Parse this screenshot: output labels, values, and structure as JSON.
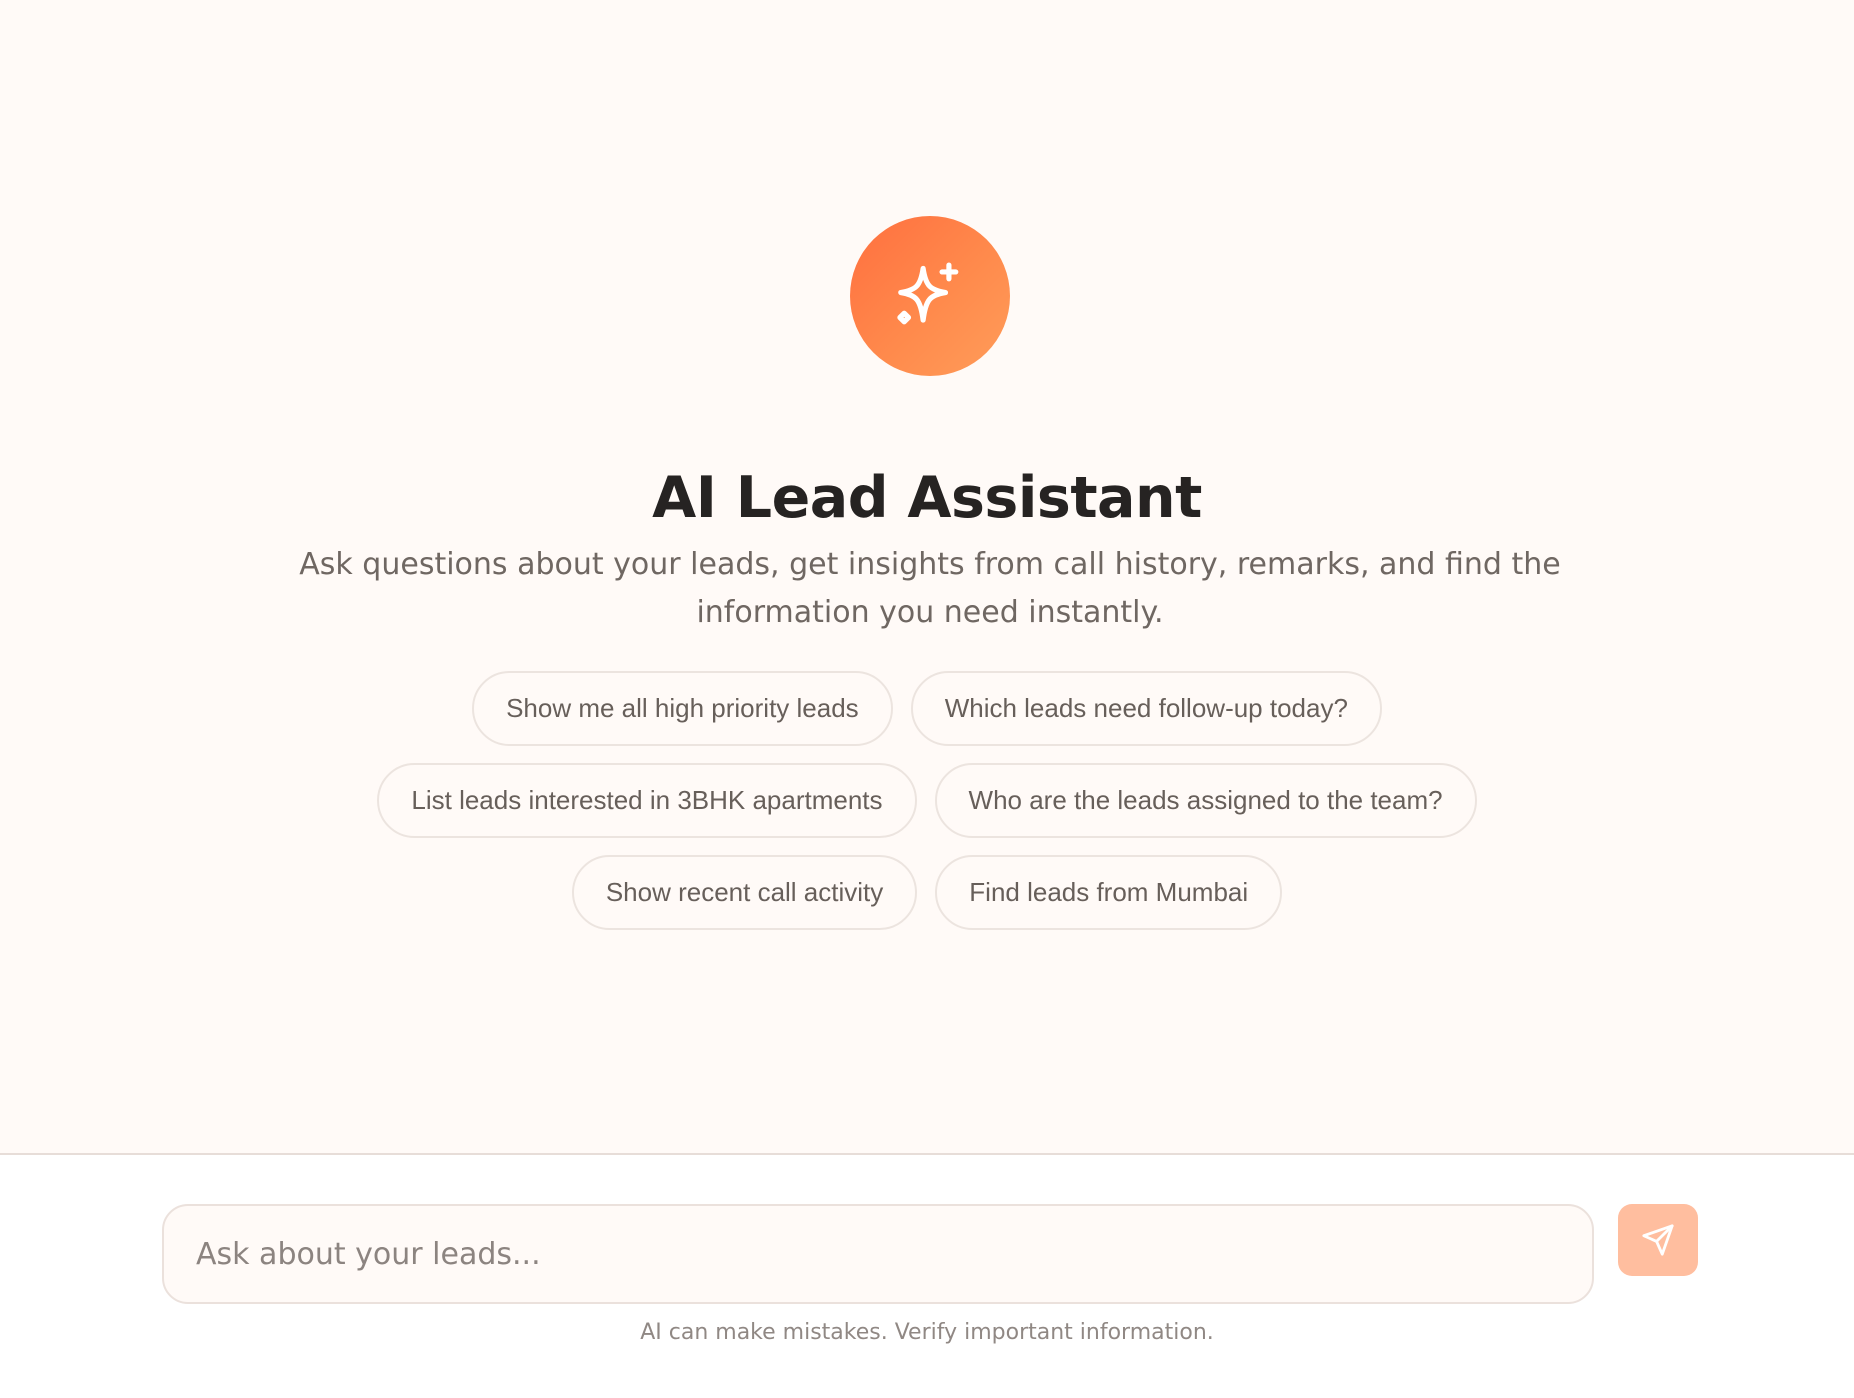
{
  "hero": {
    "icon": "sparkles-icon",
    "title": "AI Lead Assistant",
    "subtitle": "Ask questions about your leads, get insights from call history, remarks, and find the information you need instantly."
  },
  "suggestions": [
    [
      "Show me all high priority leads",
      "Which leads need follow-up today?"
    ],
    [
      "List leads interested in 3BHK apartments",
      "Who are the leads assigned to the team?"
    ],
    [
      "Show recent call activity",
      "Find leads from Mumbai"
    ]
  ],
  "composer": {
    "placeholder": "Ask about your leads...",
    "value": "",
    "send_icon": "send-icon",
    "disclaimer": "AI can make mistakes. Verify important information."
  },
  "colors": {
    "accent": "#ff7a45",
    "accent_soft": "#ffbe9f",
    "background": "#fffaf7",
    "border": "#ece4df"
  }
}
